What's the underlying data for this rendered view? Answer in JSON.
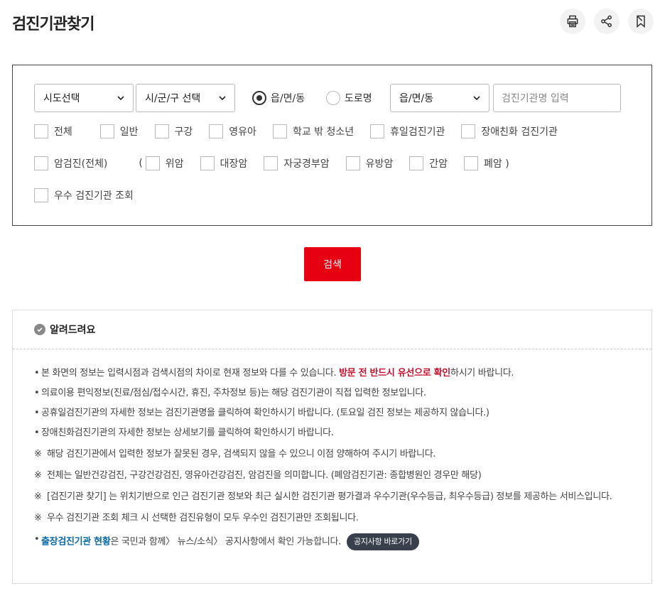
{
  "header": {
    "title": "검진기관찾기",
    "tools": [
      {
        "name": "print-icon"
      },
      {
        "name": "share-icon"
      },
      {
        "name": "bookmark-icon"
      }
    ]
  },
  "search": {
    "sido_select": "시도선택",
    "sigungu_select": "시/군/구 선택",
    "radio_eupmyeondong": "읍/면/동",
    "radio_road": "도로명",
    "eupmyeondong_select": "읍/면/동",
    "name_input_placeholder": "검진기관명 입력",
    "row1": [
      "전체",
      "일반",
      "구강",
      "영유아",
      "학교 밖 청소년",
      "휴일검진기관",
      "장애친화 검진기관"
    ],
    "row2_all": "암검진(전체)",
    "row2_open": "(",
    "row2": [
      "위암",
      "대장암",
      "자궁경부암",
      "유방암",
      "간암",
      "폐암 )"
    ],
    "row3": [
      "우수 검진기관 조회"
    ],
    "submit_label": "검색"
  },
  "notice": {
    "title": "알려드려요",
    "item1_pre": "본 화면의 정보는 입력시점과 검색시점의 차이로 현재 정보와 다를 수 있습니다.",
    "item1_red": "방문 전 반드시 유선으로 확인",
    "item1_post": "하시기 바랍니다.",
    "item2": "의료이용 편익정보(진료/점심/접수시간, 휴진, 주차정보 등)는 해당 검진기관이 직접 입력한 정보입니다.",
    "item3": "공휴일검진기관의 자세한 정보는 검진기관명을 클릭하여 확인하시기 바랍니다. (토요일 검진 정보는 제공하지 않습니다.)",
    "item4": "장애친화검진기관의 자세한 정보는 상세보기를 클릭하여 확인하시기 바랍니다.",
    "ref1": "해당 검진기관에서 입력한 정보가 잘못된 경우, 검색되지 않을 수 있으니 이점 양해하여 주시기 바랍니다.",
    "ref2": "전체는 일반건강검진, 구강건강검진, 영유아건강검진, 암검진을 의미합니다. (폐암검진기관: 종합병원인 경우만 해당)",
    "ref3": "[검진기관 찾기] 는 위치기반으로 인근 검진기관 정보와 최근 실시한 검진기관 평가결과 우수기관(우수등급, 최우수등급) 정보를 제공하는 서비스입니다.",
    "ref4": "우수 검진기관 조회 체크 시 선택한 검진유형이 모두 우수인 검진기관만 조회됩니다.",
    "last_blue": "출장검진기관 현황",
    "last_post": "은 국민과 함께〉 뉴스/소식〉 공지사항에서 확인 가능합니다.",
    "last_button": "공지사항 바로가기",
    "bullet": "•",
    "ref_mark": "※"
  }
}
